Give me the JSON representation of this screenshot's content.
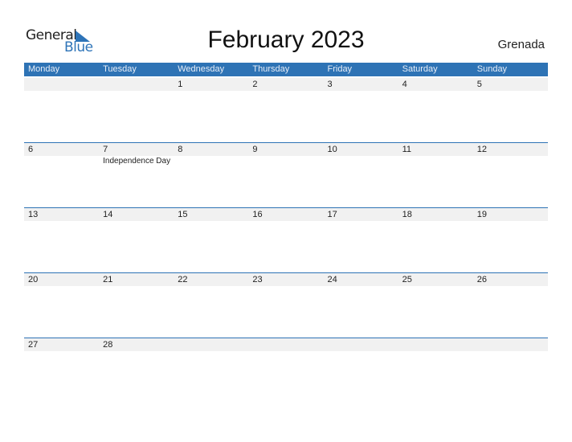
{
  "logo": {
    "text_general": "General",
    "text_blue": "Blue",
    "icon": "blue-triangle-icon"
  },
  "title": "February 2023",
  "country": "Grenada",
  "colors": {
    "header_bg": "#2e73b5",
    "accent": "#2e74b8",
    "row_band": "#f1f1f1"
  },
  "weekdays": [
    "Monday",
    "Tuesday",
    "Wednesday",
    "Thursday",
    "Friday",
    "Saturday",
    "Sunday"
  ],
  "weeks": [
    {
      "days": [
        {
          "num": "",
          "event": ""
        },
        {
          "num": "",
          "event": ""
        },
        {
          "num": "1",
          "event": ""
        },
        {
          "num": "2",
          "event": ""
        },
        {
          "num": "3",
          "event": ""
        },
        {
          "num": "4",
          "event": ""
        },
        {
          "num": "5",
          "event": ""
        }
      ]
    },
    {
      "days": [
        {
          "num": "6",
          "event": ""
        },
        {
          "num": "7",
          "event": "Independence Day"
        },
        {
          "num": "8",
          "event": ""
        },
        {
          "num": "9",
          "event": ""
        },
        {
          "num": "10",
          "event": ""
        },
        {
          "num": "11",
          "event": ""
        },
        {
          "num": "12",
          "event": ""
        }
      ]
    },
    {
      "days": [
        {
          "num": "13",
          "event": ""
        },
        {
          "num": "14",
          "event": ""
        },
        {
          "num": "15",
          "event": ""
        },
        {
          "num": "16",
          "event": ""
        },
        {
          "num": "17",
          "event": ""
        },
        {
          "num": "18",
          "event": ""
        },
        {
          "num": "19",
          "event": ""
        }
      ]
    },
    {
      "days": [
        {
          "num": "20",
          "event": ""
        },
        {
          "num": "21",
          "event": ""
        },
        {
          "num": "22",
          "event": ""
        },
        {
          "num": "23",
          "event": ""
        },
        {
          "num": "24",
          "event": ""
        },
        {
          "num": "25",
          "event": ""
        },
        {
          "num": "26",
          "event": ""
        }
      ]
    },
    {
      "days": [
        {
          "num": "27",
          "event": ""
        },
        {
          "num": "28",
          "event": ""
        },
        {
          "num": "",
          "event": ""
        },
        {
          "num": "",
          "event": ""
        },
        {
          "num": "",
          "event": ""
        },
        {
          "num": "",
          "event": ""
        },
        {
          "num": "",
          "event": ""
        }
      ]
    }
  ]
}
